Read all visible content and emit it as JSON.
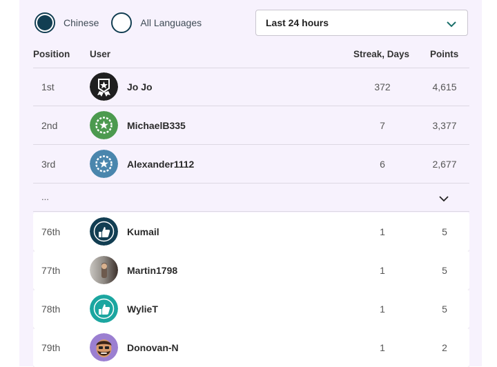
{
  "filters": {
    "language_options": [
      {
        "label": "Chinese",
        "selected": true
      },
      {
        "label": "All Languages",
        "selected": false
      }
    ],
    "time_range": {
      "value": "Last 24 hours"
    }
  },
  "table": {
    "headers": {
      "position": "Position",
      "user": "User",
      "streak": "Streak, Days",
      "points": "Points"
    },
    "top_rows": [
      {
        "position": "1st",
        "user": "Jo Jo",
        "streak": "372",
        "points": "4,615",
        "avatar": "badge-black-icon"
      },
      {
        "position": "2nd",
        "user": "MichaelB335",
        "streak": "7",
        "points": "3,377",
        "avatar": "badge-green-icon"
      },
      {
        "position": "3rd",
        "user": "Alexander1112",
        "streak": "6",
        "points": "2,677",
        "avatar": "badge-blue-icon"
      }
    ],
    "ellipsis": "...",
    "nearby_rows": [
      {
        "position": "76th",
        "user": "Kumail",
        "streak": "1",
        "points": "5",
        "avatar": "thumbs-up-navy-icon"
      },
      {
        "position": "77th",
        "user": "Martin1798",
        "streak": "1",
        "points": "5",
        "avatar": "photo-avatar"
      },
      {
        "position": "78th",
        "user": "WylieT",
        "streak": "1",
        "points": "5",
        "avatar": "thumbs-up-teal-icon"
      },
      {
        "position": "79th",
        "user": "Donovan-N",
        "streak": "1",
        "points": "2",
        "avatar": "cartoon-face-avatar"
      }
    ]
  },
  "colors": {
    "panel_bg": "#f7f2fd",
    "accent": "#123e52",
    "rank1": "#1f1f1f",
    "rank2": "#4c9a4f",
    "rank3": "#4a86ad",
    "teal": "#1ba6a0"
  }
}
